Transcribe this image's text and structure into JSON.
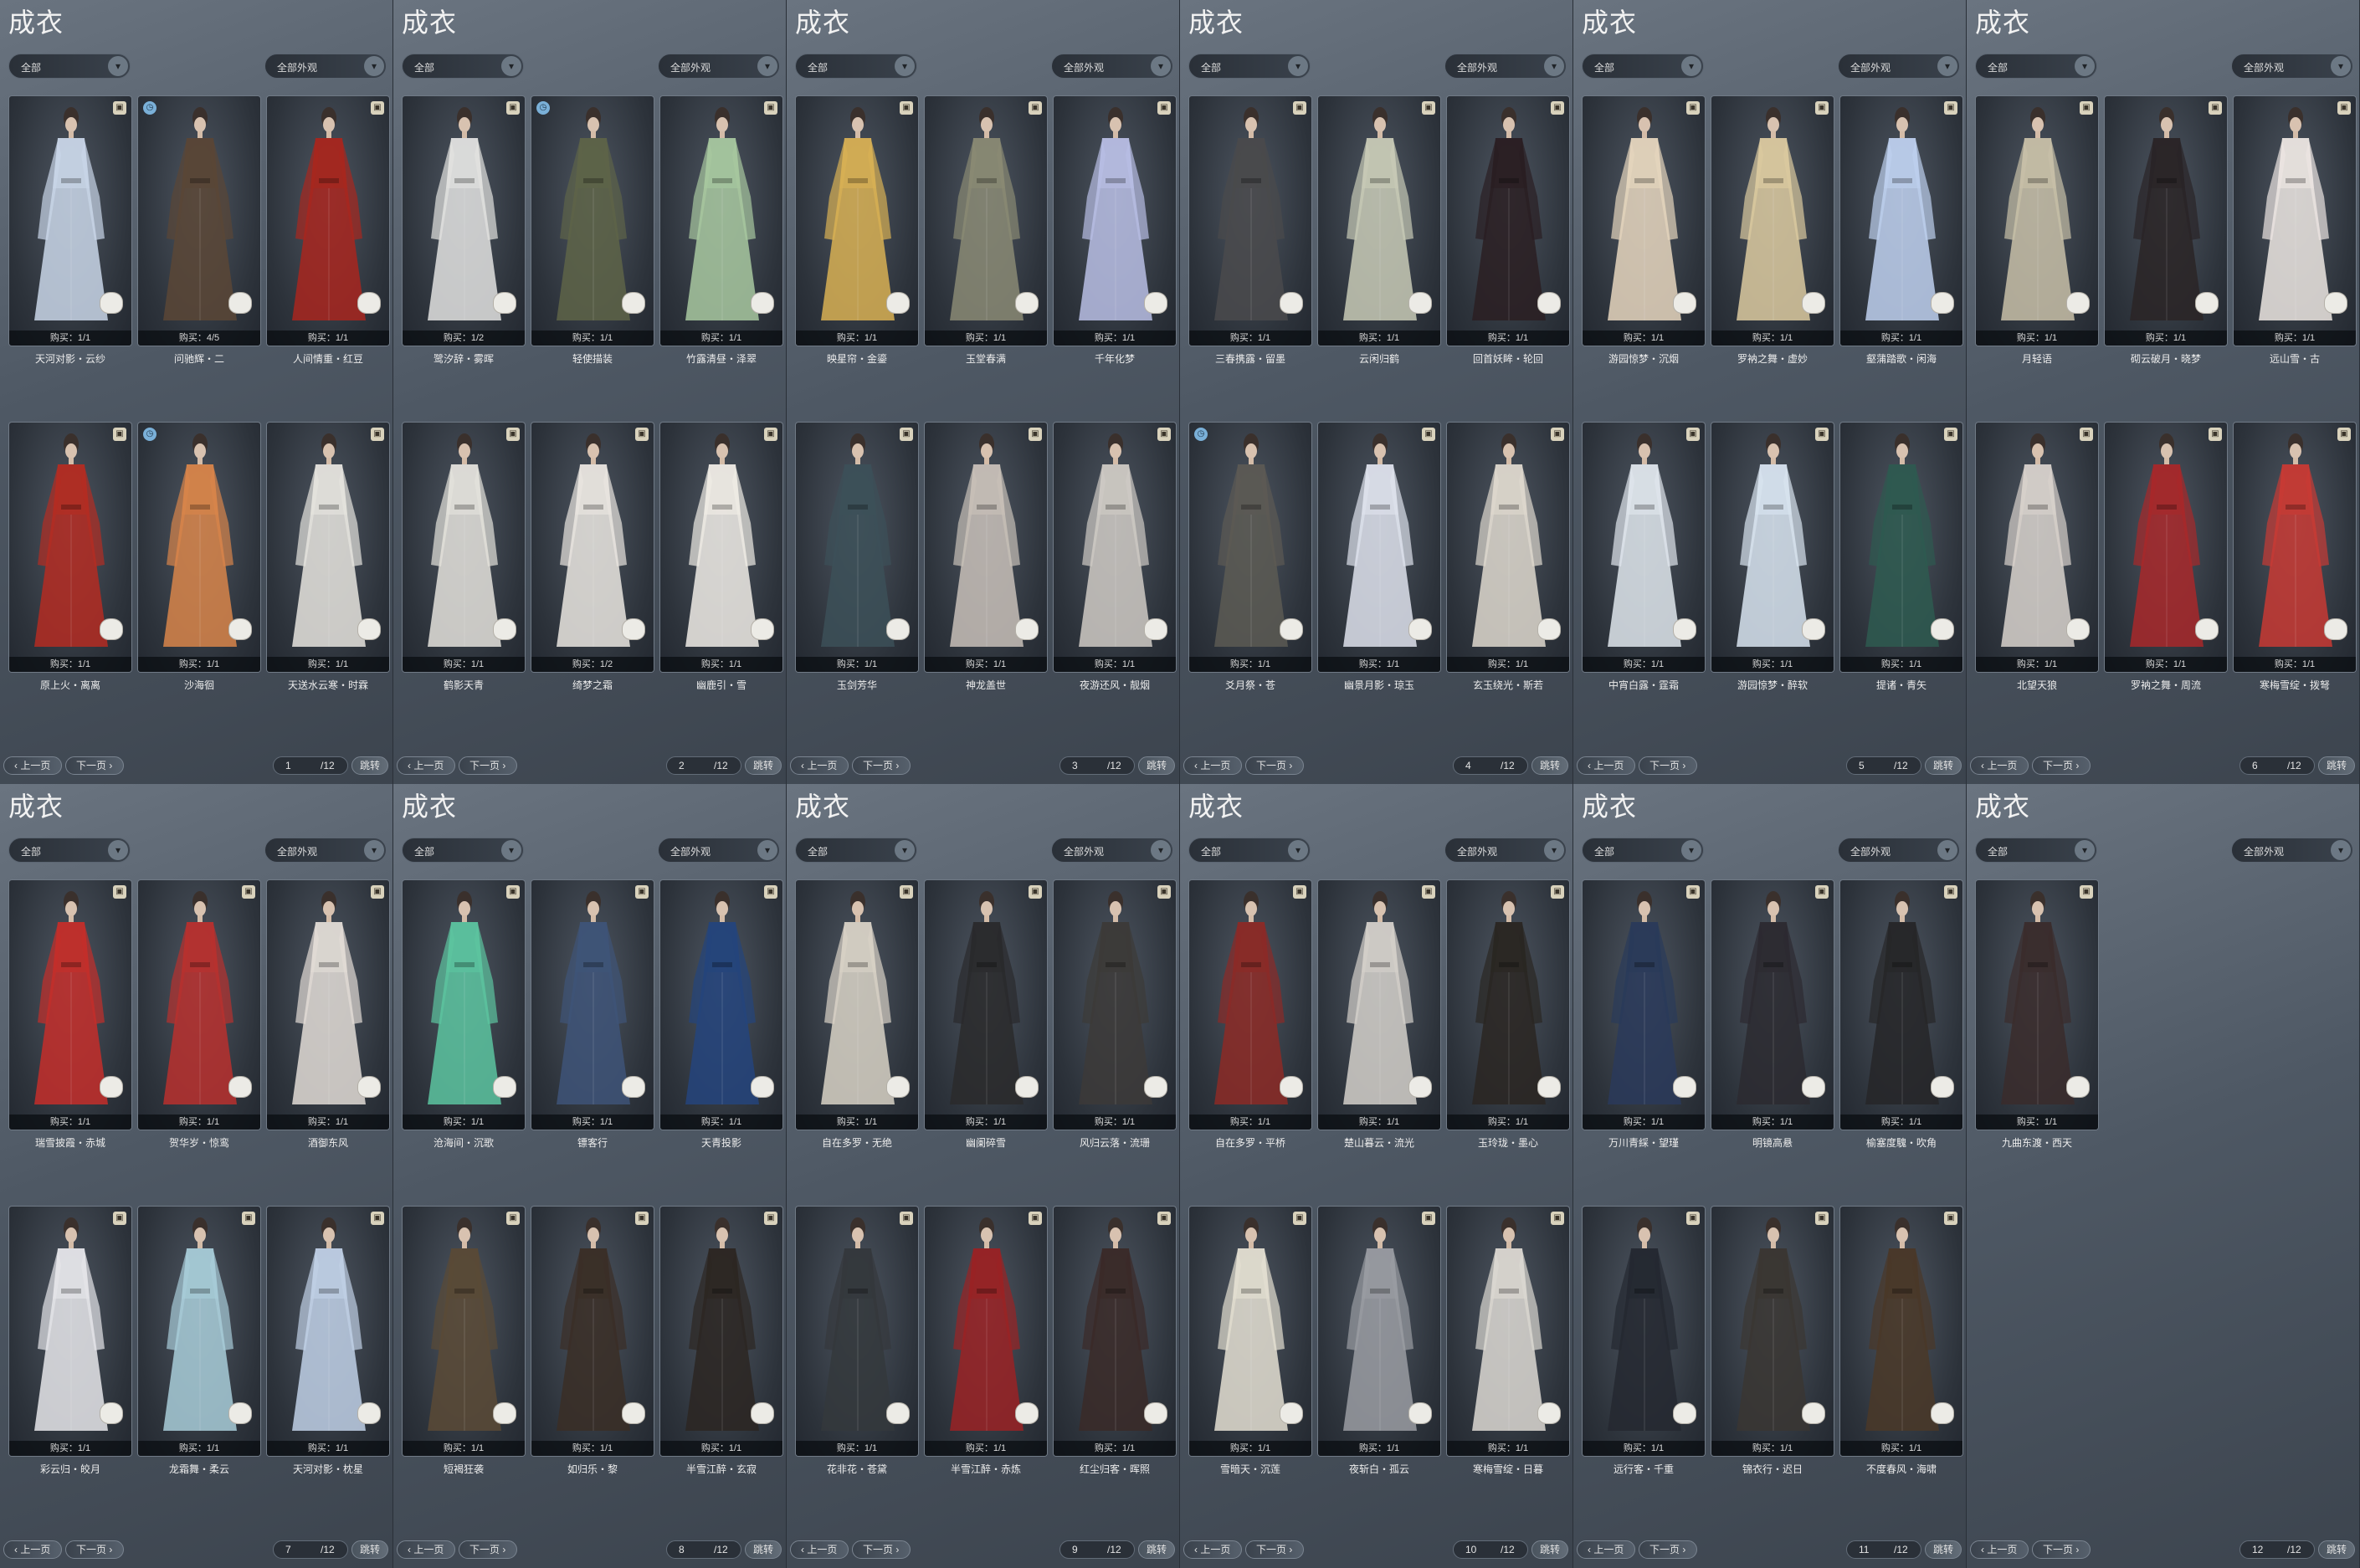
{
  "panels": [
    {
      "title": "成衣",
      "filter1": "全部",
      "filter2": "全部外观",
      "prev": "上一页",
      "next": "下一页",
      "page": "1",
      "total": "/12",
      "jump": "跳转",
      "cards": [
        {
          "name": "天河对影・云纱",
          "count": "购买：1/1",
          "color": "#c9d6e8",
          "icon": "store"
        },
        {
          "name": "问驰辉・二",
          "count": "购买：4/5",
          "color": "#5a4636",
          "icon": "limited"
        },
        {
          "name": "人间情重・红豆",
          "count": "购买：1/1",
          "color": "#a8261e",
          "icon": "store"
        },
        {
          "name": "原上火・离离",
          "count": "购买：1/1",
          "color": "#b42c22",
          "icon": "store"
        },
        {
          "name": "沙海徊",
          "count": "购买：1/1",
          "color": "#d8854a",
          "icon": "limited"
        },
        {
          "name": "天送水云寒・时霖",
          "count": "购买：1/1",
          "color": "#e6e4de",
          "icon": "store"
        }
      ]
    },
    {
      "title": "成衣",
      "filter1": "全部",
      "filter2": "全部外观",
      "prev": "上一页",
      "next": "下一页",
      "page": "2",
      "total": "/12",
      "jump": "跳转",
      "cards": [
        {
          "name": "鹭汐辞・雾晖",
          "count": "购买：1/2",
          "color": "#e2e2e0",
          "icon": "store"
        },
        {
          "name": "轻使描装",
          "count": "购买：1/1",
          "color": "#5e6448",
          "icon": "limited"
        },
        {
          "name": "竹露清昼・泽翠",
          "count": "购买：1/1",
          "color": "#a8c8a0",
          "icon": "store"
        },
        {
          "name": "鹤影天青",
          "count": "购买：1/1",
          "color": "#e4e2dc",
          "icon": "store"
        },
        {
          "name": "绮梦之霜",
          "count": "购买：1/2",
          "color": "#eae6e0",
          "icon": "store"
        },
        {
          "name": "幽鹿引・雪",
          "count": "购买：1/1",
          "color": "#f0ece6",
          "icon": "store"
        }
      ]
    },
    {
      "title": "成衣",
      "filter1": "全部",
      "filter2": "全部外观",
      "prev": "上一页",
      "next": "下一页",
      "page": "3",
      "total": "/12",
      "jump": "跳转",
      "cards": [
        {
          "name": "映星帘・金鎏",
          "count": "购买：1/1",
          "color": "#d8b054",
          "icon": "store"
        },
        {
          "name": "玉堂春满",
          "count": "购买：1/1",
          "color": "#8a8a74",
          "icon": "store"
        },
        {
          "name": "千年化梦",
          "count": "购买：1/1",
          "color": "#b8bee4",
          "icon": "store"
        },
        {
          "name": "玉剑芳华",
          "count": "购买：1/1",
          "color": "#3c5058",
          "icon": "store"
        },
        {
          "name": "神龙盖世",
          "count": "购买：1/1",
          "color": "#c8c0b8",
          "icon": "store"
        },
        {
          "name": "夜游还风・靓烟",
          "count": "购买：1/1",
          "color": "#cfcac4",
          "icon": "store"
        }
      ]
    },
    {
      "title": "成衣",
      "filter1": "全部",
      "filter2": "全部外观",
      "prev": "上一页",
      "next": "下一页",
      "page": "4",
      "total": "/12",
      "jump": "跳转",
      "cards": [
        {
          "name": "三春携露・留墨",
          "count": "购买：1/1",
          "color": "#4a4a4c",
          "icon": "store"
        },
        {
          "name": "云闲归鹤",
          "count": "购买：1/1",
          "color": "#c8cab6",
          "icon": "store"
        },
        {
          "name": "回首妖眸・轮回",
          "count": "购买：1/1",
          "color": "#2a1e22",
          "icon": "store"
        },
        {
          "name": "爻月祭・苍",
          "count": "购买：1/1",
          "color": "#5c5a54",
          "icon": "limited"
        },
        {
          "name": "幽景月影・琼玉",
          "count": "购买：1/1",
          "color": "#dee2ec",
          "icon": "store"
        },
        {
          "name": "玄玉绕光・斯若",
          "count": "购买：1/1",
          "color": "#ded8ce",
          "icon": "store"
        }
      ]
    },
    {
      "title": "成衣",
      "filter1": "全部",
      "filter2": "全部外观",
      "prev": "上一页",
      "next": "下一页",
      "page": "5",
      "total": "/12",
      "jump": "跳转",
      "cards": [
        {
          "name": "游园惊梦・沉烟",
          "count": "购买：1/1",
          "color": "#e6d6be",
          "icon": "store"
        },
        {
          "name": "罗衲之舞・虚妙",
          "count": "购买：1/1",
          "color": "#dccaa0",
          "icon": "store"
        },
        {
          "name": "壑蒲踏歌・闲海",
          "count": "购买：1/1",
          "color": "#bed0ee",
          "icon": "store"
        },
        {
          "name": "中宵白露・霆霜",
          "count": "购买：1/1",
          "color": "#dfe6ec",
          "icon": "store"
        },
        {
          "name": "游园惊梦・醉软",
          "count": "购买：1/1",
          "color": "#d8e4f0",
          "icon": "store"
        },
        {
          "name": "提诸・青矢",
          "count": "购买：1/1",
          "color": "#2e5a50",
          "icon": "store"
        }
      ]
    },
    {
      "title": "成衣",
      "filter1": "全部",
      "filter2": "全部外观",
      "prev": "上一页",
      "next": "下一页",
      "page": "6",
      "total": "/12",
      "jump": "跳转",
      "cards": [
        {
          "name": "月轻语",
          "count": "购买：1/1",
          "color": "#c8c0a8",
          "icon": "store"
        },
        {
          "name": "砌云破月・晓梦",
          "count": "购买：1/1",
          "color": "#2a2426",
          "icon": "store"
        },
        {
          "name": "远山雪・古",
          "count": "购买：1/1",
          "color": "#ece6e2",
          "icon": "store"
        },
        {
          "name": "北望天狼",
          "count": "购买：1/1",
          "color": "#d8d2cc",
          "icon": "store"
        },
        {
          "name": "罗衲之舞・周流",
          "count": "购买：1/1",
          "color": "#a8282a",
          "icon": "store"
        },
        {
          "name": "寒梅雪绽・拨弩",
          "count": "购买：1/1",
          "color": "#c83a34",
          "icon": "store"
        }
      ]
    },
    {
      "title": "成衣",
      "filter1": "全部",
      "filter2": "全部外观",
      "prev": "上一页",
      "next": "下一页",
      "page": "7",
      "total": "/12",
      "jump": "跳转",
      "cards": [
        {
          "name": "瑞雪披霞・赤城",
          "count": "购买：1/1",
          "color": "#c42e2a",
          "icon": "store"
        },
        {
          "name": "贺华岁・惊鸾",
          "count": "购买：1/1",
          "color": "#b8302e",
          "icon": "store"
        },
        {
          "name": "酒御东风",
          "count": "购买：1/1",
          "color": "#e2dcd6",
          "icon": "store"
        },
        {
          "name": "彩云归・皎月",
          "count": "购买：1/1",
          "color": "#e6e6ea",
          "icon": "store"
        },
        {
          "name": "龙霜舞・柔云",
          "count": "购买：1/1",
          "color": "#a8ccd8",
          "icon": "store"
        },
        {
          "name": "天河对影・枕星",
          "count": "购买：1/1",
          "color": "#c0d0e6",
          "icon": "store"
        }
      ]
    },
    {
      "title": "成衣",
      "filter1": "全部",
      "filter2": "全部外观",
      "prev": "上一页",
      "next": "下一页",
      "page": "8",
      "total": "/12",
      "jump": "跳转",
      "cards": [
        {
          "name": "沧海间・沉歌",
          "count": "购买：1/1",
          "color": "#5cc4a0",
          "icon": "store"
        },
        {
          "name": "镖客行",
          "count": "购买：1/1",
          "color": "#3e5478",
          "icon": "store"
        },
        {
          "name": "天青投影",
          "count": "购买：1/1",
          "color": "#24447c",
          "icon": "store"
        },
        {
          "name": "短褐狂袭",
          "count": "购买：1/1",
          "color": "#5a4a36",
          "icon": "store"
        },
        {
          "name": "如归乐・黎",
          "count": "购买：1/1",
          "color": "#3a2e26",
          "icon": "store"
        },
        {
          "name": "半雪江醉・玄寂",
          "count": "购买：1/1",
          "color": "#2c2622",
          "icon": "store"
        }
      ]
    },
    {
      "title": "成衣",
      "filter1": "全部",
      "filter2": "全部外观",
      "prev": "上一页",
      "next": "下一页",
      "page": "9",
      "total": "/12",
      "jump": "跳转",
      "cards": [
        {
          "name": "自在多罗・无绝",
          "count": "购买：1/1",
          "color": "#d8d2c6",
          "icon": "store"
        },
        {
          "name": "幽阑碎雪",
          "count": "购买：1/1",
          "color": "#2a2a2c",
          "icon": "store"
        },
        {
          "name": "风归云落・流珊",
          "count": "购买：1/1",
          "color": "#3c3a38",
          "icon": "store"
        },
        {
          "name": "花非花・苍黛",
          "count": "购买：1/1",
          "color": "#34383c",
          "icon": "store"
        },
        {
          "name": "半雪江醉・赤炼",
          "count": "购买：1/1",
          "color": "#9a2224",
          "icon": "store"
        },
        {
          "name": "红尘归客・晖照",
          "count": "购买：1/1",
          "color": "#3a2a28",
          "icon": "store"
        }
      ]
    },
    {
      "title": "成衣",
      "filter1": "全部",
      "filter2": "全部外观",
      "prev": "上一页",
      "next": "下一页",
      "page": "10",
      "total": "/12",
      "jump": "跳转",
      "cards": [
        {
          "name": "自在多罗・平桥",
          "count": "购买：1/1",
          "color": "#8c2a26",
          "icon": "store"
        },
        {
          "name": "楚山暮云・流光",
          "count": "购买：1/1",
          "color": "#d4d0ca",
          "icon": "store"
        },
        {
          "name": "玉玲珑・墨心",
          "count": "购买：1/1",
          "color": "#2a2622",
          "icon": "store"
        },
        {
          "name": "雪暗天・沉莲",
          "count": "购买：1/1",
          "color": "#e4dfd2",
          "icon": "store"
        },
        {
          "name": "夜斩白・孤云",
          "count": "购买：1/1",
          "color": "#9a9ca2",
          "icon": "store"
        },
        {
          "name": "寒梅雪绽・日暮",
          "count": "购买：1/1",
          "color": "#dcd8d2",
          "icon": "store"
        }
      ]
    },
    {
      "title": "成衣",
      "filter1": "全部",
      "filter2": "全部外观",
      "prev": "上一页",
      "next": "下一页",
      "page": "11",
      "total": "/12",
      "jump": "跳转",
      "cards": [
        {
          "name": "万川青綵・望瑾",
          "count": "购买：1/1",
          "color": "#2a3a5a",
          "icon": "store"
        },
        {
          "name": "明镜高悬",
          "count": "购买：1/1",
          "color": "#2c2a30",
          "icon": "store"
        },
        {
          "name": "榆塞度騩・吹角",
          "count": "购买：1/1",
          "color": "#262628",
          "icon": "store"
        },
        {
          "name": "远行客・千重",
          "count": "购买：1/1",
          "color": "#242830",
          "icon": "store"
        },
        {
          "name": "锦衣行・迟日",
          "count": "购买：1/1",
          "color": "#3a3632",
          "icon": "store"
        },
        {
          "name": "不度春风・海啸",
          "count": "购买：1/1",
          "color": "#4a3828",
          "icon": "store"
        }
      ]
    },
    {
      "title": "成衣",
      "filter1": "全部",
      "filter2": "全部外观",
      "prev": "上一页",
      "next": "下一页",
      "page": "12",
      "total": "/12",
      "jump": "跳转",
      "cards": [
        {
          "name": "九曲东渡・西天",
          "count": "购买：1/1",
          "color": "#3a2c2c",
          "icon": "store"
        }
      ]
    }
  ]
}
